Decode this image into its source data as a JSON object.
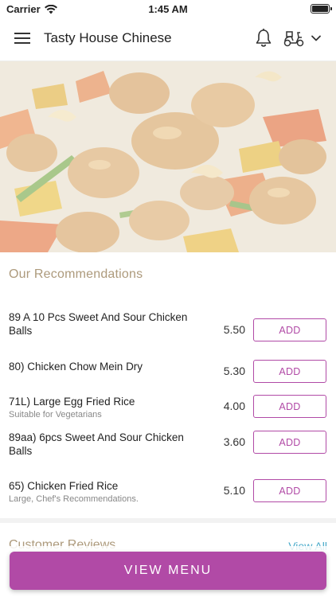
{
  "status_bar": {
    "carrier": "Carrier",
    "time": "1:45 AM"
  },
  "header": {
    "title": "Tasty House Chinese"
  },
  "recommendations": {
    "title": "Our Recommendations",
    "items": [
      {
        "name": "89 A 10 Pcs Sweet And Sour Chicken Balls",
        "subtitle": "",
        "price": "5.50",
        "button": "ADD"
      },
      {
        "name": "80) Chicken Chow Mein Dry",
        "subtitle": "",
        "price": "5.30",
        "button": "ADD"
      },
      {
        "name": "71L) Large Egg Fried Rice",
        "subtitle": "Suitable for Vegetarians",
        "price": "4.00",
        "button": "ADD"
      },
      {
        "name": "89aa) 6pcs Sweet And Sour Chicken Balls",
        "subtitle": "",
        "price": "3.60",
        "button": "ADD"
      },
      {
        "name": "65) Chicken Fried Rice",
        "subtitle": "Large, Chef's Recommendations.",
        "price": "5.10",
        "button": "ADD"
      }
    ]
  },
  "reviews": {
    "title": "Customer Reviews",
    "view_all": "View All"
  },
  "footer": {
    "view_menu": "VIEW MENU"
  },
  "colors": {
    "accent": "#b14aa6",
    "section_title": "#ad9a7c",
    "link": "#46a9c9"
  }
}
